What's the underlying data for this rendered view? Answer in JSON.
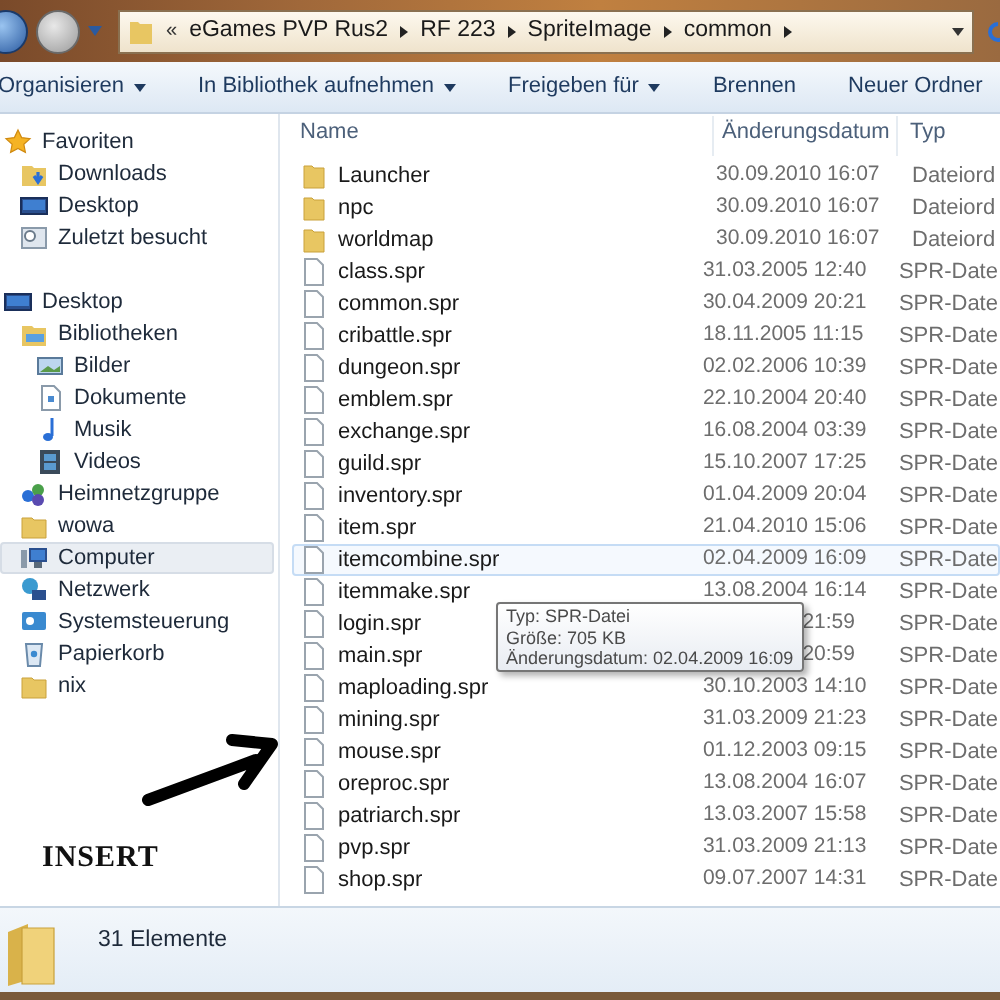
{
  "address_bar": {
    "overflow": "«",
    "crumbs": [
      "eGames PVP Rus2",
      "RF 223",
      "SpriteImage",
      "common"
    ]
  },
  "toolbar": [
    {
      "label": "Organisieren",
      "dropdown": true
    },
    {
      "label": "In Bibliothek aufnehmen",
      "dropdown": true
    },
    {
      "label": "Freigeben für",
      "dropdown": true
    },
    {
      "label": "Brennen",
      "dropdown": false
    },
    {
      "label": "Neuer Ordner",
      "dropdown": false
    }
  ],
  "sidebar": {
    "items": [
      {
        "label": "Favoriten",
        "kind": "star",
        "selected": false,
        "children": [
          {
            "label": "Downloads",
            "kind": "downloads",
            "selected": false
          },
          {
            "label": "Desktop",
            "kind": "desktop",
            "selected": false
          },
          {
            "label": "Zuletzt besucht",
            "kind": "recent",
            "selected": false
          }
        ]
      },
      {
        "label": "Desktop",
        "kind": "desktop",
        "selected": false,
        "children": [
          {
            "label": "Bibliotheken",
            "kind": "library",
            "selected": false,
            "children": [
              {
                "label": "Bilder",
                "kind": "pictures",
                "selected": false
              },
              {
                "label": "Dokumente",
                "kind": "documents",
                "selected": false
              },
              {
                "label": "Musik",
                "kind": "music",
                "selected": false
              },
              {
                "label": "Videos",
                "kind": "videos",
                "selected": false
              }
            ]
          },
          {
            "label": "Heimnetzgruppe",
            "kind": "homegroup",
            "selected": false
          },
          {
            "label": "wowa",
            "kind": "folder",
            "selected": false
          },
          {
            "label": "Computer",
            "kind": "computer",
            "selected": true
          },
          {
            "label": "Netzwerk",
            "kind": "network",
            "selected": false
          },
          {
            "label": "Systemsteuerung",
            "kind": "control",
            "selected": false
          },
          {
            "label": "Papierkorb",
            "kind": "recycle",
            "selected": false
          },
          {
            "label": "nix",
            "kind": "folder",
            "selected": false
          }
        ]
      }
    ]
  },
  "table": {
    "columns": [
      "Name",
      "Änderungsdatum",
      "Typ"
    ],
    "rows": [
      {
        "name": "Launcher",
        "date": "30.09.2010 16:07",
        "type": "Dateiord",
        "kind": "folder",
        "hovered": false
      },
      {
        "name": "npc",
        "date": "30.09.2010 16:07",
        "type": "Dateiord",
        "kind": "folder",
        "hovered": false
      },
      {
        "name": "worldmap",
        "date": "30.09.2010 16:07",
        "type": "Dateiord",
        "kind": "folder",
        "hovered": false
      },
      {
        "name": "class.spr",
        "date": "31.03.2005 12:40",
        "type": "SPR-Date",
        "kind": "file",
        "hovered": false
      },
      {
        "name": "common.spr",
        "date": "30.04.2009 20:21",
        "type": "SPR-Date",
        "kind": "file",
        "hovered": false
      },
      {
        "name": "cribattle.spr",
        "date": "18.11.2005 11:15",
        "type": "SPR-Date",
        "kind": "file",
        "hovered": false
      },
      {
        "name": "dungeon.spr",
        "date": "02.02.2006 10:39",
        "type": "SPR-Date",
        "kind": "file",
        "hovered": false
      },
      {
        "name": "emblem.spr",
        "date": "22.10.2004 20:40",
        "type": "SPR-Date",
        "kind": "file",
        "hovered": false
      },
      {
        "name": "exchange.spr",
        "date": "16.08.2004 03:39",
        "type": "SPR-Date",
        "kind": "file",
        "hovered": false
      },
      {
        "name": "guild.spr",
        "date": "15.10.2007 17:25",
        "type": "SPR-Date",
        "kind": "file",
        "hovered": false
      },
      {
        "name": "inventory.spr",
        "date": "01.04.2009 20:04",
        "type": "SPR-Date",
        "kind": "file",
        "hovered": false
      },
      {
        "name": "item.spr",
        "date": "21.04.2010 15:06",
        "type": "SPR-Date",
        "kind": "file",
        "hovered": false
      },
      {
        "name": "itemcombine.spr",
        "date": "02.04.2009 16:09",
        "type": "SPR-Date",
        "kind": "file",
        "hovered": true
      },
      {
        "name": "itemmake.spr",
        "date": "13.08.2004 16:14",
        "type": "SPR-Date",
        "kind": "file",
        "hovered": false
      },
      {
        "name": "login.spr",
        "date": "21:59",
        "type": "SPR-Date",
        "kind": "file",
        "hovered": false
      },
      {
        "name": "main.spr",
        "date": "20:59",
        "type": "SPR-Date",
        "kind": "file",
        "hovered": false
      },
      {
        "name": "maploading.spr",
        "date": "30.10.2003 14:10",
        "type": "SPR-Date",
        "kind": "file",
        "hovered": false
      },
      {
        "name": "mining.spr",
        "date": "31.03.2009 21:23",
        "type": "SPR-Date",
        "kind": "file",
        "hovered": false
      },
      {
        "name": "mouse.spr",
        "date": "01.12.2003 09:15",
        "type": "SPR-Date",
        "kind": "file",
        "hovered": false
      },
      {
        "name": "oreproc.spr",
        "date": "13.08.2004 16:07",
        "type": "SPR-Date",
        "kind": "file",
        "hovered": false
      },
      {
        "name": "patriarch.spr",
        "date": "13.03.2007 15:58",
        "type": "SPR-Date",
        "kind": "file",
        "hovered": false
      },
      {
        "name": "pvp.spr",
        "date": "31.03.2009 21:13",
        "type": "SPR-Date",
        "kind": "file",
        "hovered": false
      },
      {
        "name": "shop.spr",
        "date": "09.07.2007 14:31",
        "type": "SPR-Date",
        "kind": "file",
        "hovered": false
      }
    ]
  },
  "tooltip": {
    "lines": [
      "Typ: SPR-Datei",
      "Größe: 705 KB",
      "Änderungsdatum: 02.04.2009 16:09"
    ]
  },
  "annotation": {
    "label": "INSERT"
  },
  "status_bar": {
    "count": "31 Elemente"
  }
}
